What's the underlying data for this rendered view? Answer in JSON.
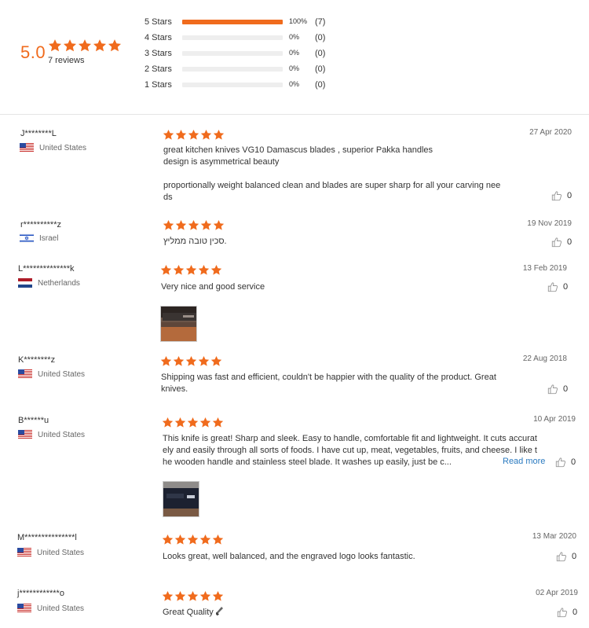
{
  "colors": {
    "accent": "#f06b1d",
    "link": "#2a7ac0",
    "bar_bg": "#eeeeee"
  },
  "summary": {
    "average": "5.0",
    "average_stars": 5,
    "review_count_label": "7 reviews",
    "distribution": [
      {
        "label": "5 Stars",
        "pct": "100%",
        "fill": 1.0,
        "count": "(7)"
      },
      {
        "label": "4 Stars",
        "pct": "0%",
        "fill": 0.0,
        "count": "(0)"
      },
      {
        "label": "3 Stars",
        "pct": "0%",
        "fill": 0.0,
        "count": "(0)"
      },
      {
        "label": "2 Stars",
        "pct": "0%",
        "fill": 0.0,
        "count": "(0)"
      },
      {
        "label": "1 Stars",
        "pct": "0%",
        "fill": 0.0,
        "count": "(0)"
      }
    ]
  },
  "reviews": [
    {
      "name": "J********L",
      "country": "United States",
      "flag": "us-flag-icon",
      "stars": 5,
      "date": "27 Apr 2020",
      "text": "great kitchen knives VG10 Damascus blades , superior Pakka handles\ndesign is asymmetrical beauty\n\nproportionally weight balanced clean and blades are super sharp for all your carving nee\nds",
      "helpful": "0"
    },
    {
      "name": "r**********z",
      "country": "Israel",
      "flag": "israel-flag-icon",
      "stars": 5,
      "date": "19 Nov 2019",
      "text": "סכין טובה ממליץ.",
      "helpful": "0"
    },
    {
      "name": "L**************k",
      "country": "Netherlands",
      "flag": "netherlands-flag-icon",
      "stars": 5,
      "date": "13 Feb 2019",
      "text": "Very nice and good service",
      "helpful": "0",
      "photo": "knife-photo"
    },
    {
      "name": "K********z",
      "country": "United States",
      "flag": "us-flag-icon",
      "stars": 5,
      "date": "22 Aug 2018",
      "text": "Shipping was fast and efficient, couldn't be happier with the quality of the product. Great\nknives.",
      "helpful": "0"
    },
    {
      "name": "B******u",
      "country": "United States",
      "flag": "us-flag-icon",
      "stars": 5,
      "date": "10 Apr 2019",
      "text": "This knife is great! Sharp and sleek. Easy to handle, comfortable fit and lightweight. It cuts accurat\nely and easily through all sorts of foods. I have cut up, meat, vegetables, fruits, and cheese. I like t\nhe wooden handle and stainless steel blade. It washes up easily, just be c...",
      "read_more": "Read more",
      "helpful": "0",
      "photo": "knife-photo"
    },
    {
      "name": "M***************l",
      "country": "United States",
      "flag": "us-flag-icon",
      "stars": 5,
      "date": "13 Mar 2020",
      "text": "Looks great, well balanced, and the engraved logo looks fantastic.",
      "helpful": "0"
    },
    {
      "name": "j************o",
      "country": "United States",
      "flag": "us-flag-icon",
      "stars": 5,
      "date": "02 Apr 2019",
      "text": "Great Quality",
      "emoji": "knife-emoji-icon",
      "helpful": "0"
    }
  ]
}
